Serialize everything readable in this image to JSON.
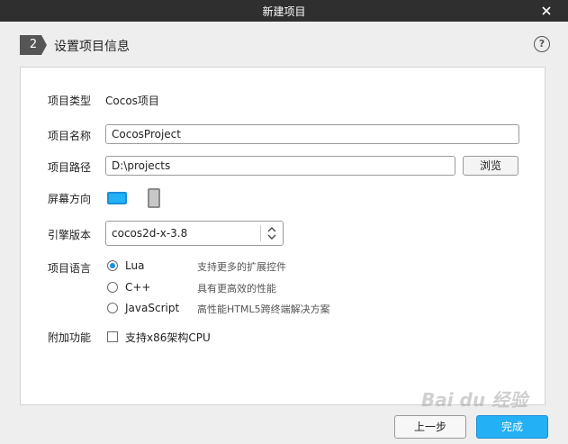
{
  "window": {
    "title": "新建项目"
  },
  "step": {
    "number": "2",
    "title": "设置项目信息"
  },
  "help": {
    "glyph": "?"
  },
  "form": {
    "type_label": "项目类型",
    "type_value": "Cocos项目",
    "name_label": "项目名称",
    "name_value": "CocosProject",
    "path_label": "项目路径",
    "path_value": "D:\\projects",
    "browse_label": "浏览",
    "orientation_label": "屏幕方向",
    "orientation_selected": "landscape",
    "engine_label": "引擎版本",
    "engine_value": "cocos2d-x-3.8",
    "language_label": "项目语言",
    "languages": [
      {
        "name": "Lua",
        "desc": "支持更多的扩展控件",
        "checked": true
      },
      {
        "name": "C++",
        "desc": "具有更高效的性能",
        "checked": false
      },
      {
        "name": "JavaScript",
        "desc": "高性能HTML5跨终端解决方案",
        "checked": false
      }
    ],
    "extra_label": "附加功能",
    "extra_option": "支持x86架构CPU",
    "extra_checked": false
  },
  "buttons": {
    "prev": "上一步",
    "finish": "完成"
  },
  "watermark": "Bai du 经验",
  "colors": {
    "accent": "#23b0f5",
    "titlebar": "#2f2f2f"
  }
}
